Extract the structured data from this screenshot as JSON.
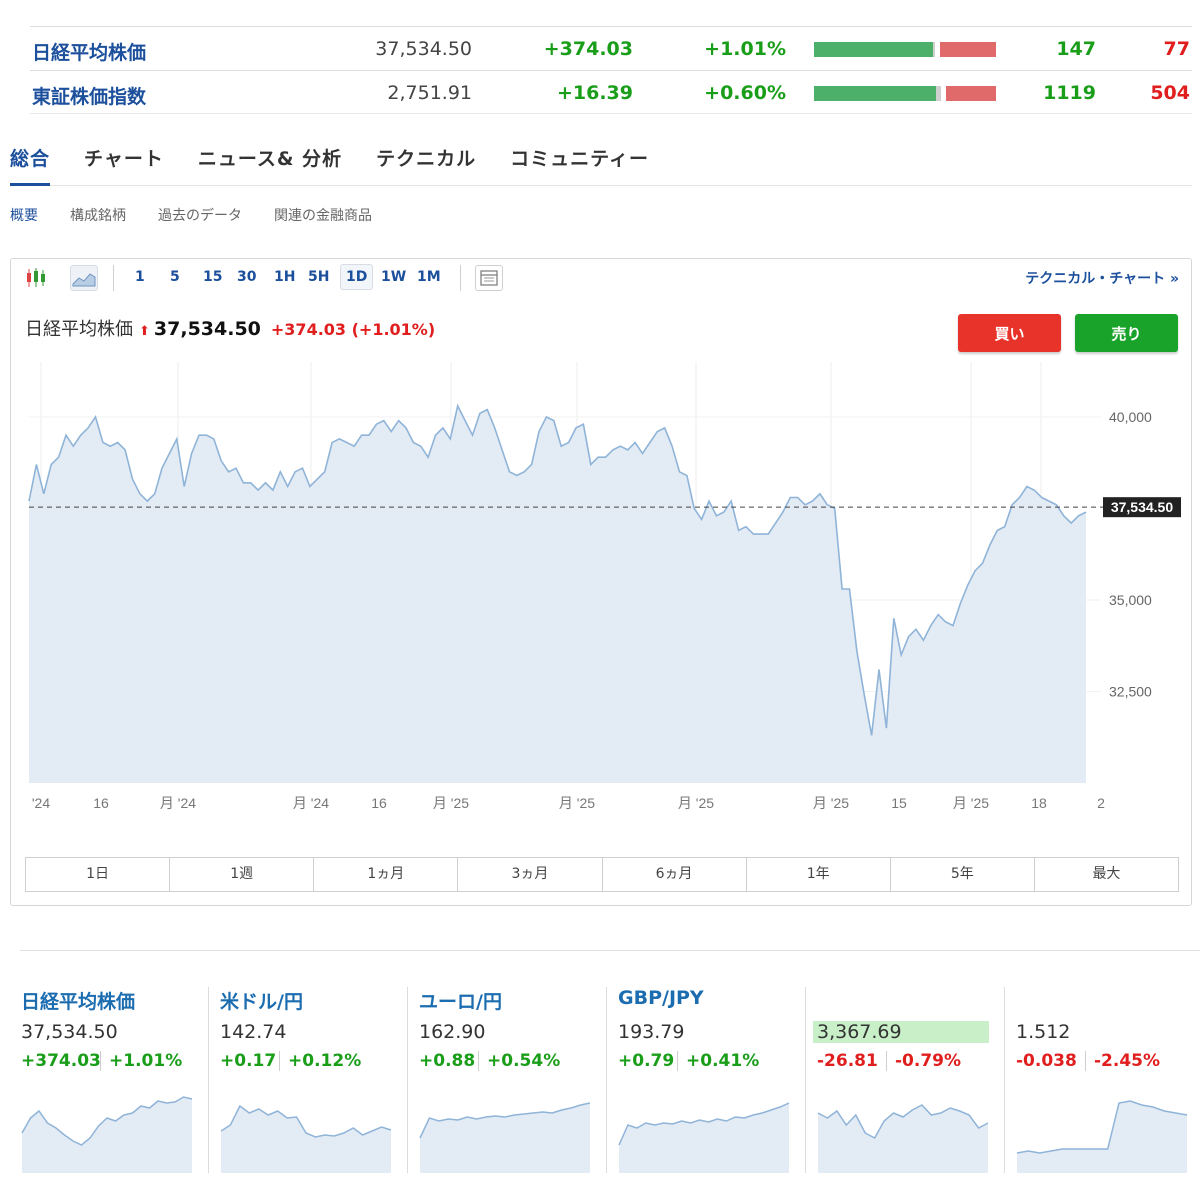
{
  "indices": [
    {
      "name": "日経平均株価",
      "price": "37,534.50",
      "change": "+374.03",
      "pct": "+1.01%",
      "up": "147",
      "down": "77",
      "bar": {
        "up": 147,
        "neutral": 1,
        "down": 77
      }
    },
    {
      "name": "東証株価指数",
      "price": "2,751.91",
      "change": "+16.39",
      "pct": "+0.60%",
      "up": "1119",
      "down": "504",
      "bar": {
        "up": 1119,
        "neutral": 50,
        "down": 504
      }
    }
  ],
  "main_tabs": [
    "総合",
    "チャート",
    "ニュース& 分析",
    "テクニカル",
    "コミュニティー"
  ],
  "sub_tabs": [
    "概要",
    "構成銘柄",
    "過去のデータ",
    "関連の金融商品"
  ],
  "toolbar": {
    "intervals": [
      "1",
      "5",
      "15",
      "30",
      "1H",
      "5H",
      "1D",
      "1W",
      "1M"
    ],
    "active_interval": "1D",
    "technical_link": "テクニカル・チャート »"
  },
  "chart_header": {
    "name": "日経平均株価",
    "arrow": "⬆",
    "price": "37,534.50",
    "change": "+374.03 (+1.01%)"
  },
  "trade_buttons": {
    "buy": "買い",
    "sell": "売り"
  },
  "chart_data": {
    "type": "area",
    "ylim": [
      30000,
      41500
    ],
    "yticks": [
      "40,000",
      "35,000",
      "32,500"
    ],
    "ytick_values": [
      40000,
      35000,
      32500
    ],
    "current_value": 37534.5,
    "current_label": "37,534.50",
    "xticks": [
      "'24",
      "16",
      "月 '24",
      "月 '24",
      "16",
      "月 '25",
      "月 '25",
      "月 '25",
      "月 '25",
      "15",
      "月 '25",
      "18",
      "2"
    ],
    "values": [
      37700,
      38700,
      37900,
      38700,
      38900,
      39500,
      39200,
      39500,
      39700,
      40000,
      39300,
      39200,
      39300,
      39100,
      38300,
      37900,
      37700,
      37900,
      38600,
      39000,
      39400,
      38100,
      39000,
      39500,
      39500,
      39400,
      38800,
      38500,
      38600,
      38200,
      38200,
      38000,
      38200,
      38000,
      38500,
      38100,
      38500,
      38600,
      38100,
      38300,
      38500,
      39300,
      39400,
      39300,
      39200,
      39500,
      39500,
      39800,
      39900,
      39600,
      39900,
      39700,
      39300,
      39200,
      38900,
      39500,
      39700,
      39400,
      40300,
      39900,
      39500,
      40100,
      40200,
      39700,
      39100,
      38500,
      38400,
      38500,
      38700,
      39600,
      40000,
      39900,
      39200,
      39300,
      39700,
      39800,
      38700,
      38900,
      38900,
      39100,
      39200,
      39100,
      39300,
      39000,
      39300,
      39600,
      39700,
      39200,
      38500,
      38400,
      37500,
      37200,
      37700,
      37300,
      37400,
      37700,
      36900,
      37000,
      36800,
      36800,
      36800,
      37100,
      37400,
      37800,
      37800,
      37600,
      37700,
      37900,
      37600,
      37500,
      35300,
      35300,
      33600,
      32400,
      31300,
      33100,
      31500,
      34500,
      33500,
      34000,
      34200,
      33900,
      34300,
      34600,
      34400,
      34300,
      34900,
      35400,
      35800,
      36000,
      36500,
      36900,
      37000,
      37600,
      37800,
      38100,
      38000,
      37800,
      37700,
      37600,
      37300,
      37100,
      37300,
      37400
    ]
  },
  "range_buttons": [
    "1日",
    "1週",
    "1ヵ月",
    "3ヵ月",
    "6ヵ月",
    "1年",
    "5年",
    "最大"
  ],
  "cards": [
    {
      "name": "日経平均株価",
      "price": "37,534.50",
      "change": "+374.03",
      "pct": "+1.01%",
      "direction": "up",
      "highlight": false,
      "spark": [
        40,
        55,
        62,
        50,
        45,
        38,
        32,
        28,
        35,
        47,
        55,
        52,
        58,
        60,
        67,
        65,
        72,
        70,
        71,
        76,
        74
      ]
    },
    {
      "name": "米ドル/円",
      "price": "142.74",
      "change": "+0.17",
      "pct": "+0.12%",
      "direction": "up",
      "highlight": false,
      "spark": [
        42,
        48,
        67,
        60,
        64,
        58,
        62,
        55,
        56,
        40,
        36,
        38,
        37,
        40,
        45,
        38,
        42,
        46,
        43
      ]
    },
    {
      "name": "ユーロ/円",
      "price": "162.90",
      "change": "+0.88",
      "pct": "+0.54%",
      "direction": "up",
      "highlight": false,
      "spark": [
        35,
        55,
        52,
        54,
        53,
        56,
        54,
        56,
        57,
        56,
        58,
        59,
        60,
        61,
        60,
        63,
        65,
        68,
        70
      ]
    },
    {
      "name": "GBP/JPY",
      "price": "193.79",
      "change": "+0.79",
      "pct": "+0.41%",
      "direction": "up",
      "highlight": false,
      "spark": [
        28,
        48,
        45,
        50,
        48,
        50,
        49,
        52,
        50,
        53,
        51,
        54,
        52,
        56,
        55,
        58,
        60,
        63,
        66,
        70
      ]
    },
    {
      "name": "",
      "price": "3,367.69",
      "change": "-26.81",
      "pct": "-0.79%",
      "direction": "down",
      "highlight": true,
      "spark": [
        60,
        55,
        62,
        48,
        58,
        40,
        35,
        52,
        60,
        56,
        63,
        68,
        58,
        60,
        65,
        62,
        58,
        45,
        50
      ]
    },
    {
      "name": "",
      "price": "1.512",
      "change": "-0.038",
      "pct": "-2.45%",
      "direction": "down",
      "highlight": false,
      "spark": [
        20,
        22,
        20,
        22,
        24,
        24,
        24,
        24,
        24,
        70,
        72,
        68,
        66,
        62,
        60,
        58
      ]
    }
  ]
}
